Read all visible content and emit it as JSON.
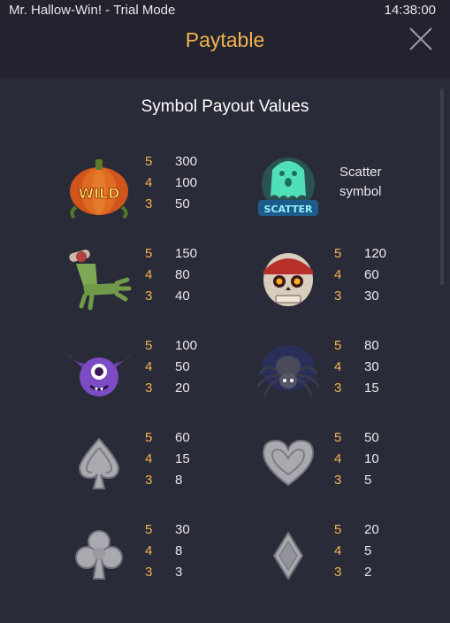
{
  "header": {
    "app_title": "Mr. Hallow-Win! - Trial Mode",
    "clock": "14:38:00",
    "page_title": "Paytable"
  },
  "content": {
    "section_title": "Symbol Payout Values"
  },
  "symbols": [
    {
      "name": "wild-pumpkin",
      "icon_text": "WILD",
      "pays": [
        {
          "count": "5",
          "value": "300"
        },
        {
          "count": "4",
          "value": "100"
        },
        {
          "count": "3",
          "value": "50"
        }
      ]
    },
    {
      "name": "scatter-ghost",
      "icon_text": "SCATTER",
      "description_line1": "Scatter",
      "description_line2": "symbol"
    },
    {
      "name": "zombie-hand",
      "pays": [
        {
          "count": "5",
          "value": "150"
        },
        {
          "count": "4",
          "value": "80"
        },
        {
          "count": "3",
          "value": "40"
        }
      ]
    },
    {
      "name": "pirate-skull",
      "pays": [
        {
          "count": "5",
          "value": "120"
        },
        {
          "count": "4",
          "value": "60"
        },
        {
          "count": "3",
          "value": "30"
        }
      ]
    },
    {
      "name": "purple-bat",
      "pays": [
        {
          "count": "5",
          "value": "100"
        },
        {
          "count": "4",
          "value": "50"
        },
        {
          "count": "3",
          "value": "20"
        }
      ]
    },
    {
      "name": "spider",
      "pays": [
        {
          "count": "5",
          "value": "80"
        },
        {
          "count": "4",
          "value": "30"
        },
        {
          "count": "3",
          "value": "15"
        }
      ]
    },
    {
      "name": "spade",
      "pays": [
        {
          "count": "5",
          "value": "60"
        },
        {
          "count": "4",
          "value": "15"
        },
        {
          "count": "3",
          "value": "8"
        }
      ]
    },
    {
      "name": "heart",
      "pays": [
        {
          "count": "5",
          "value": "50"
        },
        {
          "count": "4",
          "value": "10"
        },
        {
          "count": "3",
          "value": "5"
        }
      ]
    },
    {
      "name": "club",
      "pays": [
        {
          "count": "5",
          "value": "30"
        },
        {
          "count": "4",
          "value": "8"
        },
        {
          "count": "3",
          "value": "3"
        }
      ]
    },
    {
      "name": "diamond",
      "pays": [
        {
          "count": "5",
          "value": "20"
        },
        {
          "count": "4",
          "value": "5"
        },
        {
          "count": "3",
          "value": "2"
        }
      ]
    }
  ],
  "colors": {
    "accent": "#f2b252",
    "background": "#2a2b38",
    "header_background": "#22232e",
    "text": "#e8e8ec"
  },
  "icons": {
    "close": "close-icon"
  }
}
